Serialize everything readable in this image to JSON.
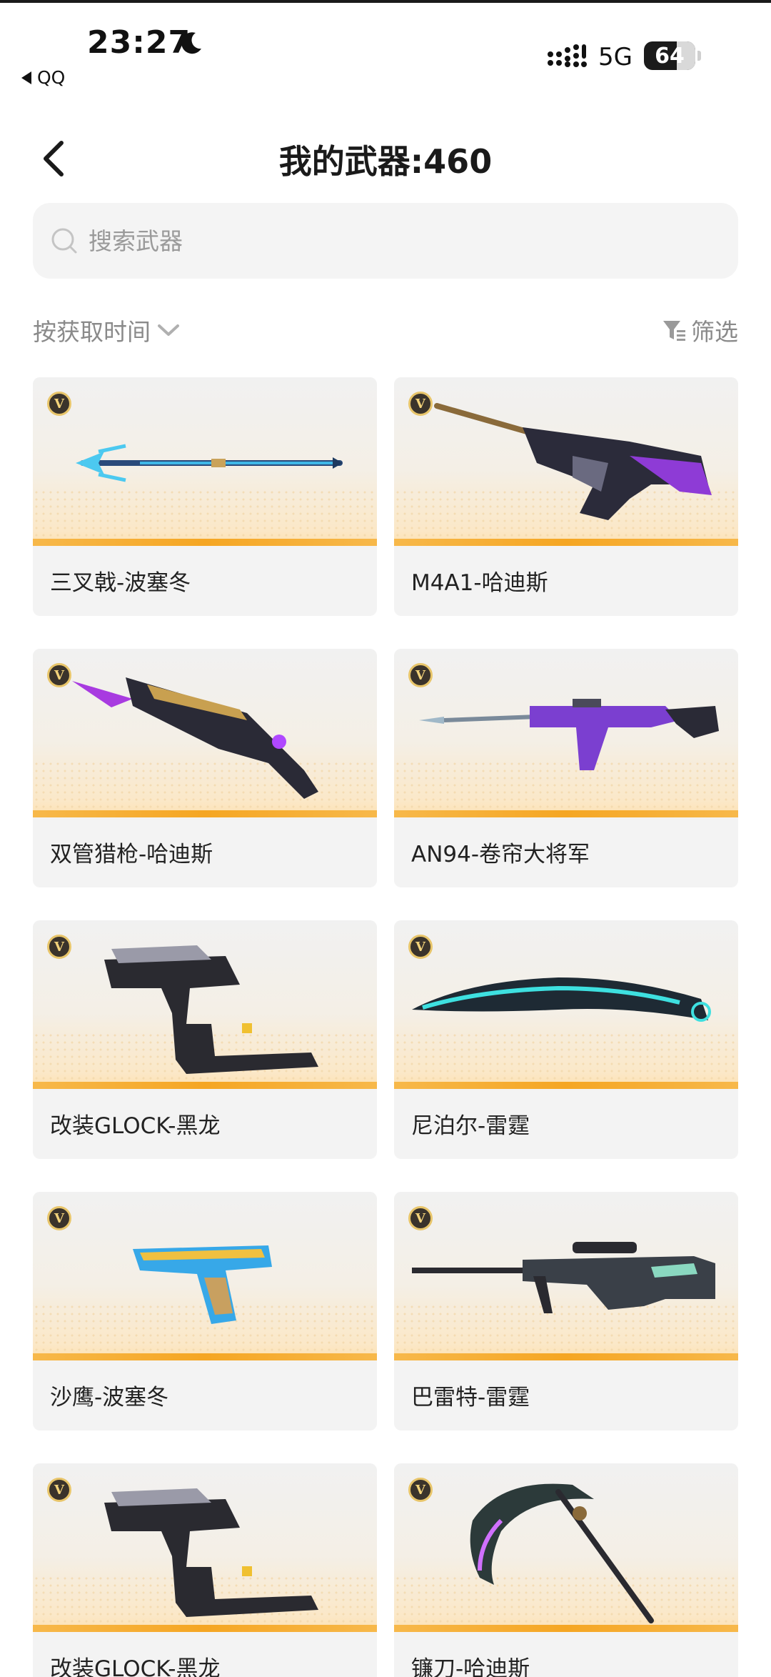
{
  "status_bar": {
    "time": "23:27",
    "back_app": "QQ",
    "network": "5G",
    "battery": "64"
  },
  "header": {
    "title": "我的武器:460"
  },
  "search": {
    "placeholder": "搜索武器"
  },
  "toolbar": {
    "sort_label": "按获取时间",
    "filter_label": "筛选"
  },
  "weapons": [
    {
      "name": "三叉戟-波塞冬",
      "badge": "V",
      "icon": "trident-icon"
    },
    {
      "name": "M4A1-哈迪斯",
      "badge": "V",
      "icon": "rifle-icon"
    },
    {
      "name": "双管猎枪-哈迪斯",
      "badge": "V",
      "icon": "shotgun-icon"
    },
    {
      "name": "AN94-卷帘大将军",
      "badge": "V",
      "icon": "rifle-icon"
    },
    {
      "name": "改装GLOCK-黑龙",
      "badge": "V",
      "icon": "pistol-icon"
    },
    {
      "name": "尼泊尔-雷霆",
      "badge": "V",
      "icon": "knife-icon"
    },
    {
      "name": "沙鹰-波塞冬",
      "badge": "V",
      "icon": "pistol-icon"
    },
    {
      "name": "巴雷特-雷霆",
      "badge": "V",
      "icon": "sniper-icon"
    },
    {
      "name": "改装GLOCK-黑龙",
      "badge": "V",
      "icon": "pistol-icon"
    },
    {
      "name": "镰刀-哈迪斯",
      "badge": "V",
      "icon": "scythe-icon"
    }
  ],
  "colors": {
    "accent": "#f5a623",
    "badge_gold": "#e8c56a"
  }
}
